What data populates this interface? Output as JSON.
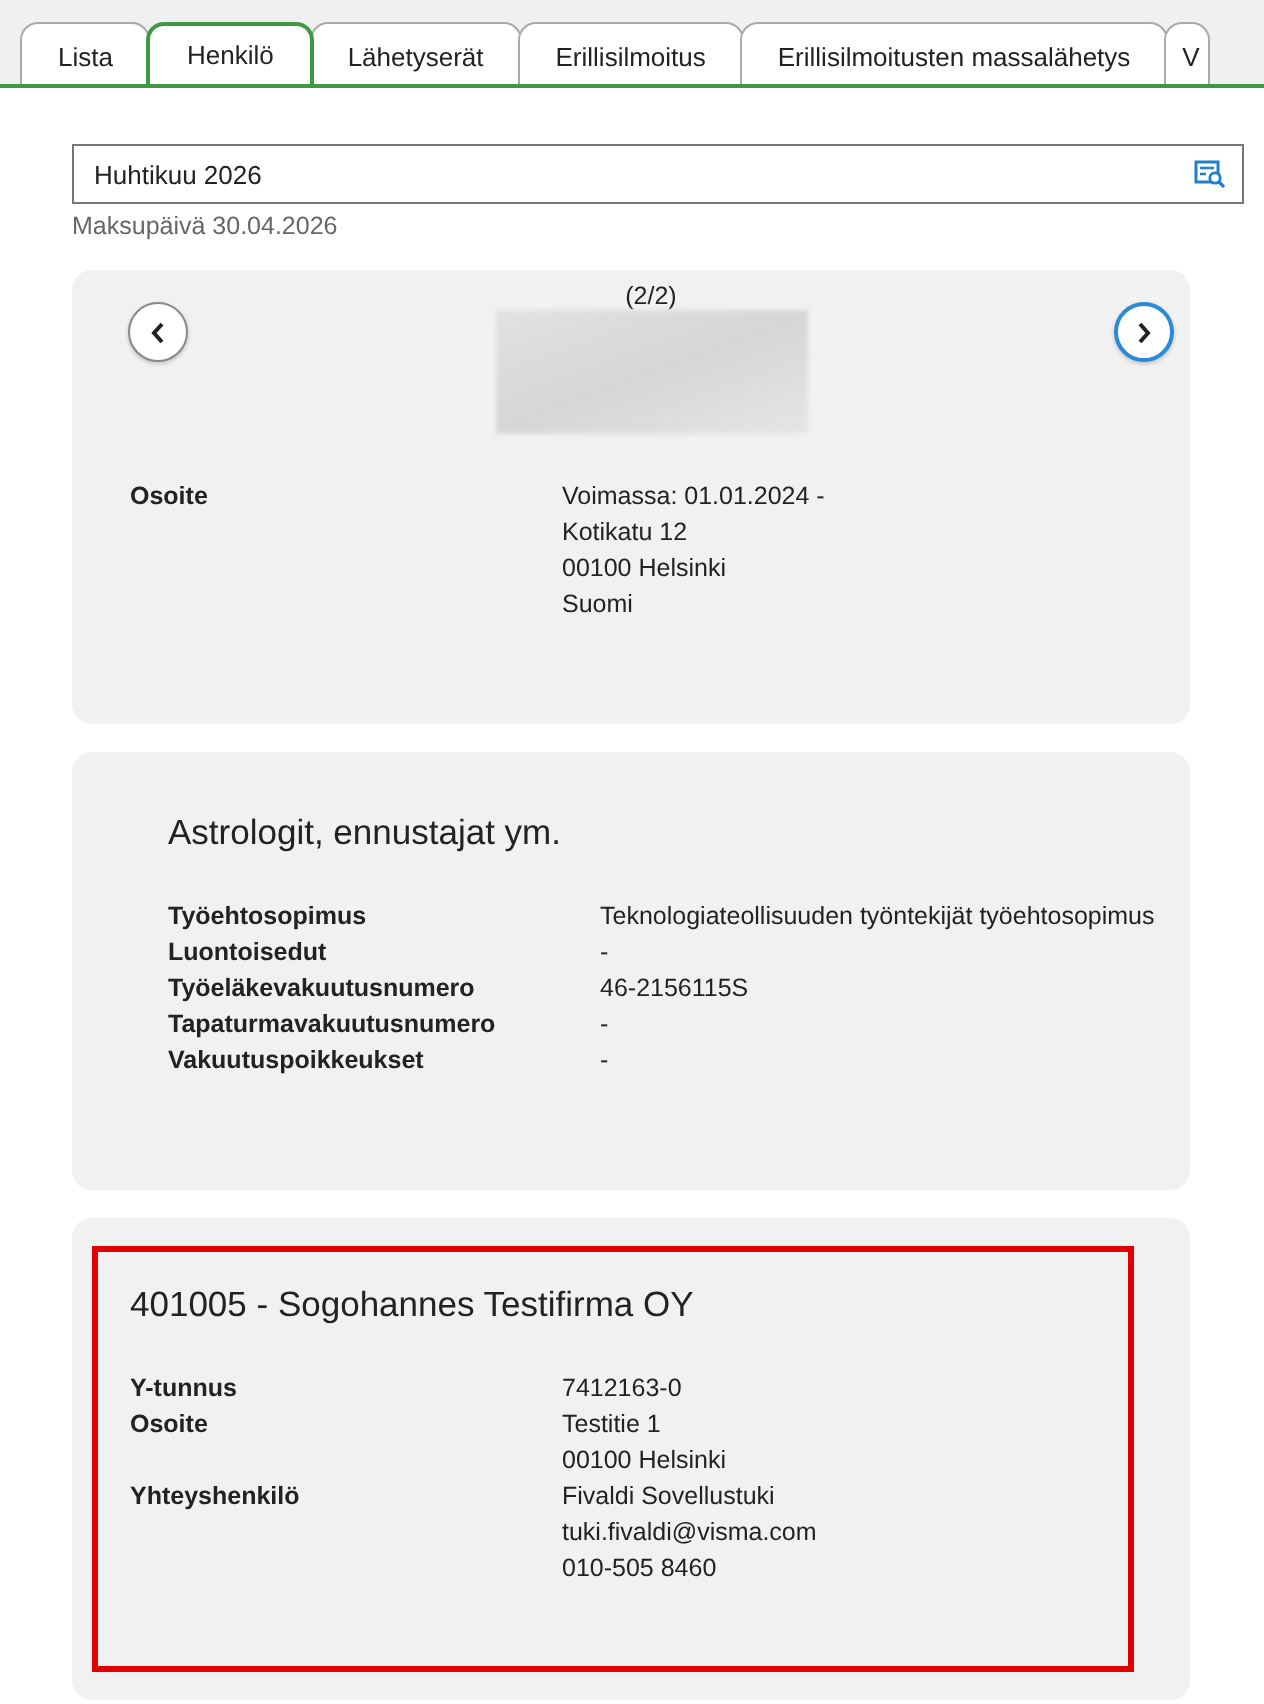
{
  "tabs": [
    {
      "label": "Lista",
      "selected": false
    },
    {
      "label": "Henkilö",
      "selected": true
    },
    {
      "label": "Lähetyserät",
      "selected": false
    },
    {
      "label": "Erillisilmoitus",
      "selected": false
    },
    {
      "label": "Erillisilmoitusten massalähetys",
      "selected": false
    },
    {
      "label": "V",
      "selected": false
    }
  ],
  "period_field": {
    "value": "Huhtikuu 2026"
  },
  "payment_date": "Maksupäivä 30.04.2026",
  "person_card": {
    "pager": "(2/2)",
    "prev_focused": false,
    "next_focused": true,
    "rows": [
      {
        "label": "Osoite",
        "values": [
          "Voimassa: 01.01.2024 -",
          "Kotikatu 12",
          "00100 Helsinki",
          "Suomi"
        ]
      }
    ]
  },
  "occupation_card": {
    "title": "Astrologit, ennustajat ym.",
    "highlighted": false,
    "rows": [
      {
        "label": "Työehtosopimus",
        "values": [
          "Teknologiateollisuuden työntekijät työehtosopimus"
        ]
      },
      {
        "label": "Luontoisedut",
        "values": [
          "-"
        ]
      },
      {
        "label": "Työeläkevakuutusnumero",
        "values": [
          "46-2156115S"
        ]
      },
      {
        "label": "Tapaturmavakuutusnumero",
        "values": [
          "-"
        ]
      },
      {
        "label": "Vakuutuspoikkeukset",
        "values": [
          "-"
        ]
      }
    ]
  },
  "company_card": {
    "title": "401005 - Sogohannes Testifirma OY",
    "highlighted": true,
    "rows": [
      {
        "label": "Y-tunnus",
        "values": [
          "7412163-0"
        ]
      },
      {
        "label": "Osoite",
        "values": [
          "Testitie 1",
          "00100 Helsinki"
        ]
      },
      {
        "label": "Yhteyshenkilö",
        "values": [
          "Fivaldi Sovellustuki",
          "tuki.fivaldi@visma.com",
          "010-505 8460"
        ]
      }
    ]
  }
}
